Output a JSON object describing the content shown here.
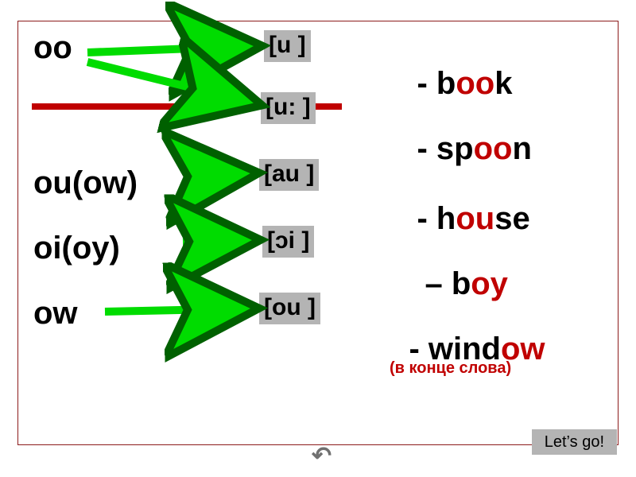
{
  "pairs": {
    "oo": "oo",
    "ou_ow": "ou(ow)",
    "oi_oy": "oi(oy)",
    "ow": "ow"
  },
  "pronunciations": {
    "u_short": "[u ]",
    "u_long": "[u: ]",
    "au": "[au ]",
    "oi": "[ɔi ]",
    "ou": "[ou ]"
  },
  "words": {
    "book": {
      "pre": "- b",
      "hl": "oo",
      "post": "k"
    },
    "spoon": {
      "pre": "- sp",
      "hl": "oo",
      "post": "n"
    },
    "house": {
      "pre": "- h",
      "hl": "ou",
      "post": "se"
    },
    "boy": {
      "pre": "– b",
      "hl": "oy",
      "post": ""
    },
    "window": {
      "pre": "- wind",
      "hl": "ow",
      "post": ""
    }
  },
  "note": "(в конце слова)",
  "button": {
    "go": "Let’s go!"
  },
  "icons": {
    "undo": "↶"
  },
  "colors": {
    "accent": "#c00000",
    "box": "#b4b4b4",
    "arrow": "#00dc00",
    "arrowStroke": "#006000"
  }
}
